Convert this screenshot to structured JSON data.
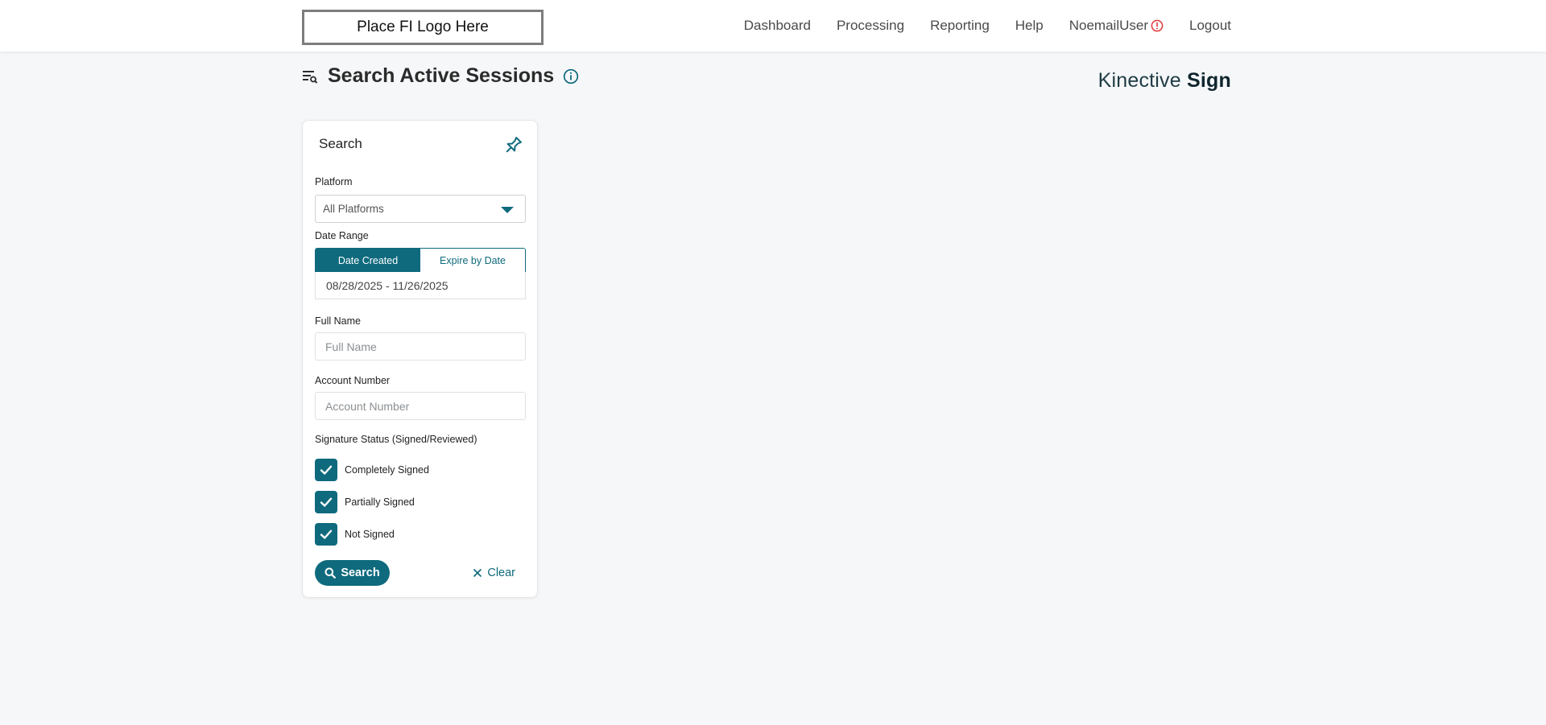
{
  "header": {
    "logo_text": "Place FI Logo Here",
    "nav": [
      {
        "label": "Dashboard"
      },
      {
        "label": "Processing"
      },
      {
        "label": "Reporting"
      },
      {
        "label": "Help"
      },
      {
        "label": "NoemailUser"
      },
      {
        "label": "Logout"
      }
    ],
    "user_alert_icon": "alert-circle-icon",
    "alert_color": "#e03a3a"
  },
  "page": {
    "title": "Search Active Sessions",
    "title_icon": "filter-search-icon",
    "info_icon": "info-icon"
  },
  "brand": {
    "name_light": "Kinective",
    "name_bold": "Sign"
  },
  "search_panel": {
    "title": "Search",
    "pin_icon": "pin-icon",
    "platform": {
      "label": "Platform",
      "value": "All Platforms"
    },
    "date_range": {
      "label": "Date Range",
      "tabs": [
        {
          "label": "Date Created",
          "active": true
        },
        {
          "label": "Expire by Date",
          "active": false
        }
      ],
      "value": "08/28/2025 - 11/26/2025"
    },
    "full_name": {
      "label": "Full Name",
      "placeholder": "Full Name"
    },
    "account_number": {
      "label": "Account Number",
      "placeholder": "Account Number"
    },
    "signature_status": {
      "label": "Signature Status (Signed/Reviewed)",
      "options": [
        {
          "label": "Completely Signed",
          "checked": true
        },
        {
          "label": "Partially Signed",
          "checked": true
        },
        {
          "label": "Not Signed",
          "checked": true
        }
      ]
    },
    "search_button": "Search",
    "clear_button": "Clear"
  },
  "colors": {
    "accent": "#0f6a7d",
    "background": "#f5f7f9"
  }
}
